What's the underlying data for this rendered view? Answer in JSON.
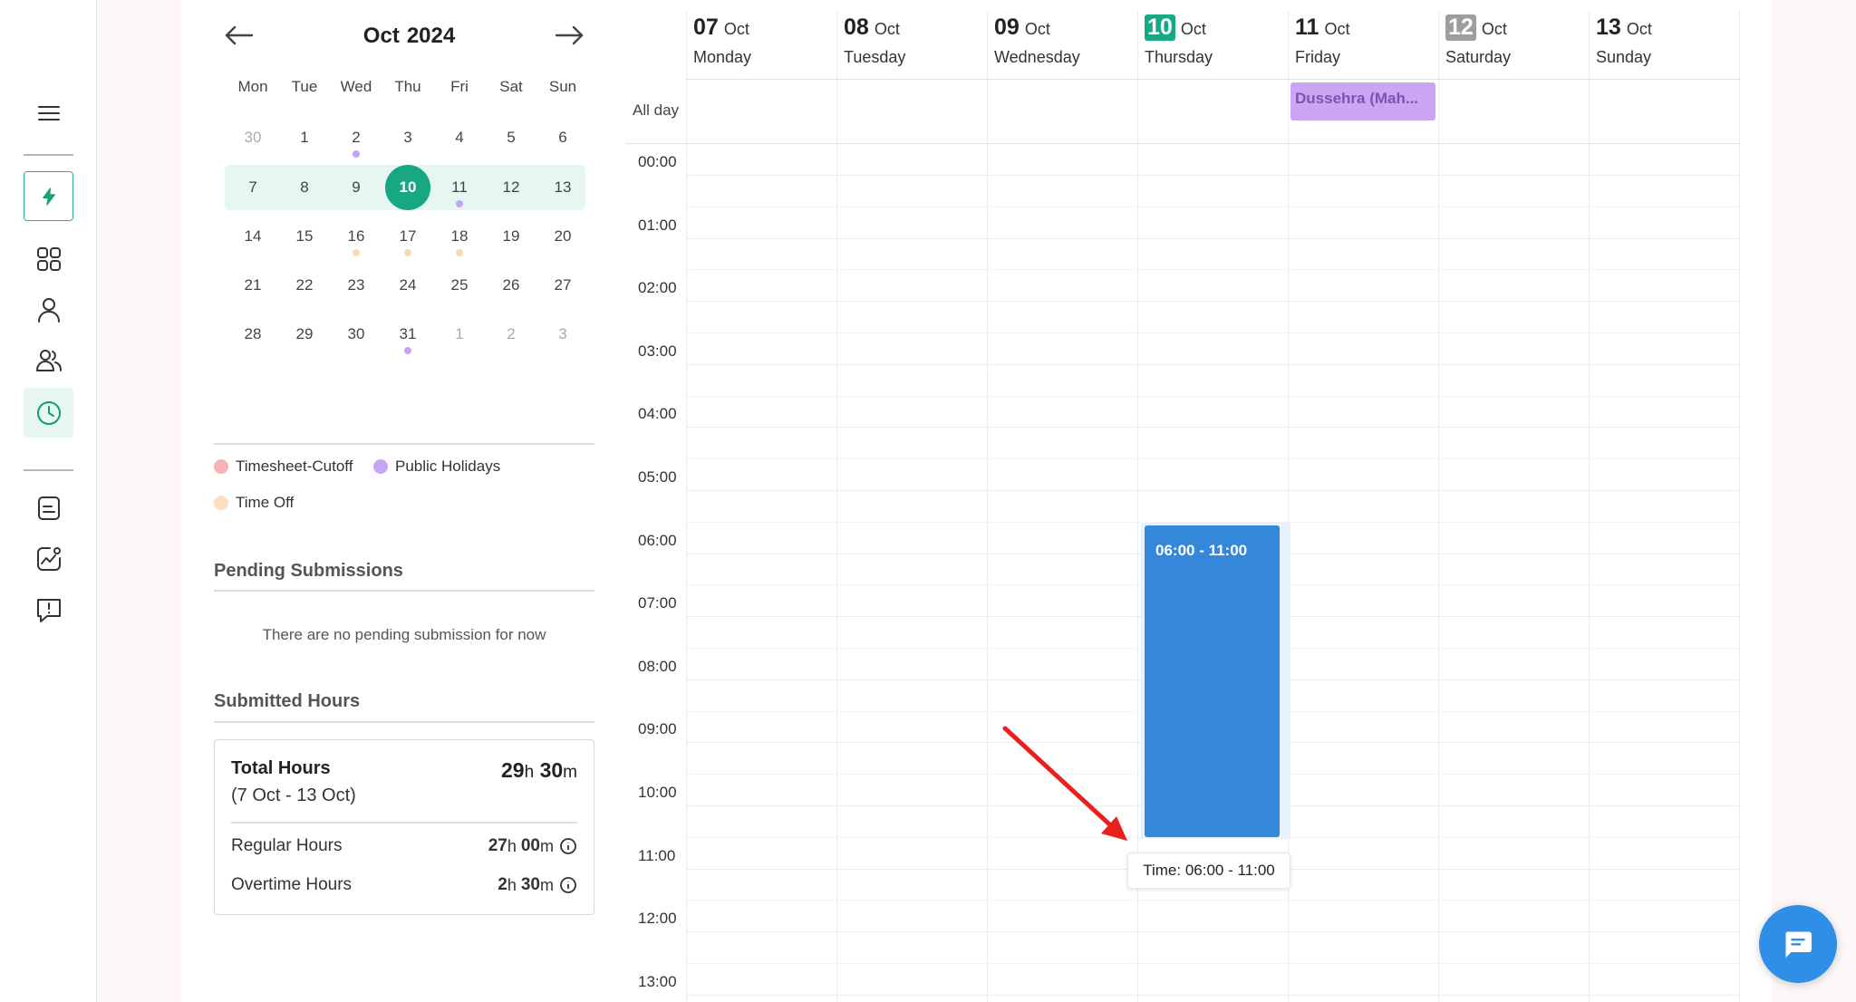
{
  "mini_calendar": {
    "month": "Oct",
    "year": "2024",
    "weekdays": [
      "Mon",
      "Tue",
      "Wed",
      "Thu",
      "Fri",
      "Sat",
      "Sun"
    ],
    "weeks": [
      [
        {
          "d": "30",
          "muted": true
        },
        {
          "d": "1"
        },
        {
          "d": "2",
          "dot": "purple"
        },
        {
          "d": "3"
        },
        {
          "d": "4"
        },
        {
          "d": "5"
        },
        {
          "d": "6"
        }
      ],
      [
        {
          "d": "7"
        },
        {
          "d": "8"
        },
        {
          "d": "9"
        },
        {
          "d": "10",
          "today": true
        },
        {
          "d": "11",
          "dot": "purple"
        },
        {
          "d": "12"
        },
        {
          "d": "13"
        }
      ],
      [
        {
          "d": "14"
        },
        {
          "d": "15"
        },
        {
          "d": "16",
          "dot": "peach"
        },
        {
          "d": "17",
          "dot": "peach"
        },
        {
          "d": "18",
          "dot": "peach"
        },
        {
          "d": "19"
        },
        {
          "d": "20"
        }
      ],
      [
        {
          "d": "21"
        },
        {
          "d": "22"
        },
        {
          "d": "23"
        },
        {
          "d": "24"
        },
        {
          "d": "25"
        },
        {
          "d": "26"
        },
        {
          "d": "27"
        }
      ],
      [
        {
          "d": "28"
        },
        {
          "d": "29"
        },
        {
          "d": "30"
        },
        {
          "d": "31",
          "dot": "purple"
        },
        {
          "d": "1",
          "muted": true
        },
        {
          "d": "2",
          "muted": true
        },
        {
          "d": "3",
          "muted": true
        }
      ]
    ]
  },
  "legend": {
    "timesheet_cutoff": "Timesheet-Cutoff",
    "public_holidays": "Public Holidays",
    "time_off": "Time Off",
    "colors": {
      "timesheet_cutoff": "#f6b3b3",
      "public_holidays": "#c9a6f5",
      "time_off": "#fae0bf"
    }
  },
  "pending": {
    "title": "Pending Submissions",
    "empty": "There are no pending submission for now"
  },
  "submitted": {
    "title": "Submitted Hours",
    "total_label": "Total Hours",
    "range": "(7 Oct - 13 Oct)",
    "total_h": "29",
    "total_m": "30",
    "regular_label": "Regular Hours",
    "regular_h": "27",
    "regular_m": "00",
    "overtime_label": "Overtime Hours",
    "overtime_h": "2",
    "overtime_m": "30"
  },
  "week": {
    "days": [
      {
        "num": "07",
        "mon": "Oct",
        "name": "Monday",
        "badge": ""
      },
      {
        "num": "08",
        "mon": "Oct",
        "name": "Tuesday",
        "badge": ""
      },
      {
        "num": "09",
        "mon": "Oct",
        "name": "Wednesday",
        "badge": ""
      },
      {
        "num": "10",
        "mon": "Oct",
        "name": "Thursday",
        "badge": "green"
      },
      {
        "num": "11",
        "mon": "Oct",
        "name": "Friday",
        "badge": ""
      },
      {
        "num": "12",
        "mon": "Oct",
        "name": "Saturday",
        "badge": "gray"
      },
      {
        "num": "13",
        "mon": "Oct",
        "name": "Sunday",
        "badge": ""
      }
    ],
    "allday_label": "All day",
    "times": [
      "00:00",
      "01:00",
      "02:00",
      "03:00",
      "04:00",
      "05:00",
      "06:00",
      "07:00",
      "08:00",
      "09:00",
      "10:00",
      "11:00",
      "12:00",
      "13:00"
    ],
    "holiday_event": "Dussehra (Mah...",
    "time_event": "06:00 - 11:00",
    "tooltip": "Time: 06:00 - 11:00"
  },
  "colors": {
    "accent": "#17a882",
    "event_blue": "#3588d9",
    "holiday_purple": "#cba6f3",
    "arrow_red": "#e8211f"
  }
}
